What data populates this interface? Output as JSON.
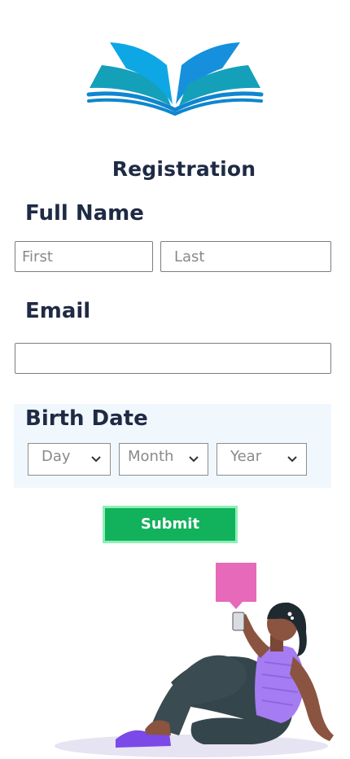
{
  "form": {
    "title": "Registration",
    "full_name_label": "Full Name",
    "first_placeholder": "First",
    "last_placeholder": "Last",
    "email_label": "Email",
    "email_value": "",
    "birth_date_label": "Birth Date",
    "day_selected": "Day",
    "month_selected": "Month",
    "year_selected": "Year",
    "submit_label": "Submit"
  },
  "colors": {
    "heading": "#1f2a44",
    "submit_bg": "#12b15c",
    "submit_border": "#8df0b5",
    "birth_panel_bg": "#f1f8fd",
    "logo_blue": "#0fa3e0",
    "logo_teal": "#15a9b8"
  },
  "icons": [
    "open-book-logo-icon",
    "chevron-down-icon",
    "woman-with-phone-illustration",
    "chat-bubble-icon"
  ]
}
